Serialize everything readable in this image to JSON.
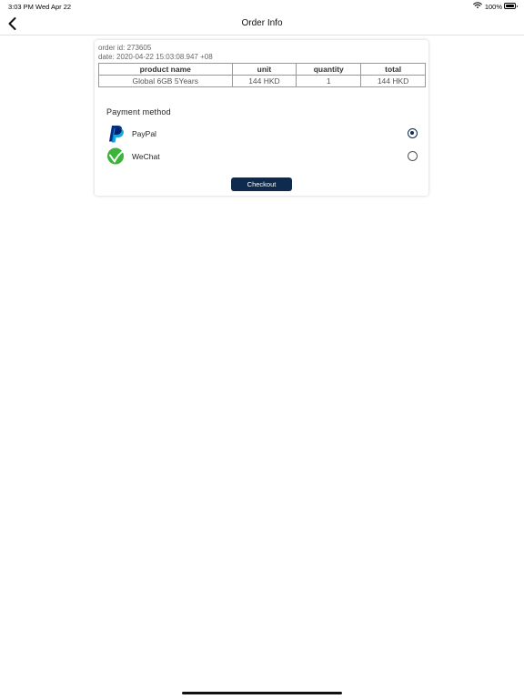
{
  "status_bar": {
    "time": "3:03 PM  Wed Apr 22",
    "battery_pct": "100%"
  },
  "nav": {
    "title": "Order Info",
    "back_icon": "chevron-left-icon"
  },
  "order": {
    "id_text": "order id: 273605",
    "date_text": "date: 2020-04-22 15:03:08.947 +08",
    "columns": [
      "product name",
      "unit",
      "quantity",
      "total"
    ],
    "rows": [
      [
        "Global 6GB 5Years",
        "144 HKD",
        "1",
        "144 HKD"
      ]
    ]
  },
  "payment": {
    "title": "Payment method",
    "methods": [
      {
        "label": "PayPal",
        "icon": "paypal-logo-icon",
        "selected": true,
        "brand_color": "#003087"
      },
      {
        "label": "WeChat",
        "icon": "wechat-logo-icon",
        "selected": false,
        "brand_color": "#3db33a"
      }
    ]
  },
  "checkout_label": "Checkout",
  "colors": {
    "accent": "#0f2a4f",
    "border": "#999999",
    "meta_text": "#666666"
  }
}
